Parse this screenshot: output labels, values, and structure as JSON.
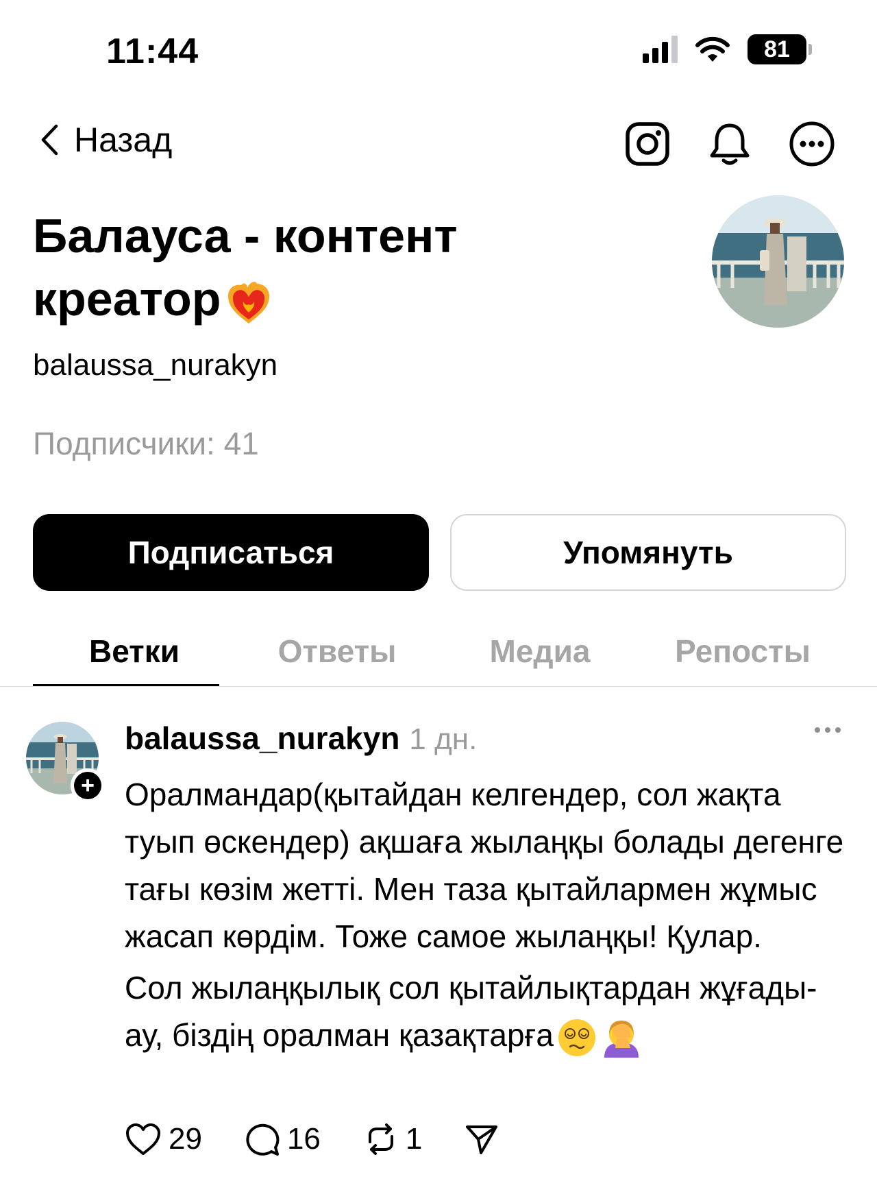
{
  "status_bar": {
    "time": "11:44",
    "battery": "81"
  },
  "nav": {
    "back_label": "Назад"
  },
  "profile": {
    "name": "Балауса - контент креатор",
    "handle": "balaussa_nurakyn",
    "followers": "Подписчики: 41"
  },
  "actions": {
    "follow_label": "Подписаться",
    "mention_label": "Упомянуть"
  },
  "tabs": [
    {
      "label": "Ветки",
      "active": true
    },
    {
      "label": "Ответы",
      "active": false
    },
    {
      "label": "Медиа",
      "active": false
    },
    {
      "label": "Репосты",
      "active": false
    }
  ],
  "post": {
    "author": "balaussa_nurakyn",
    "time": "1 дн.",
    "paragraph_1": "Оралмандар(қытайдан келгендер, сол жақта туып өскендер) ақшаға жылаңқы болады дегенге тағы көзім жетті. Мен таза қытайлармен жұмыс жасап көрдім. Тоже самое жылаңқы! Қулар.",
    "paragraph_2": "Сол жылаңқылық сол қытайлықтардан жұғады-ау, біздің оралман қазақтарға",
    "likes": "29",
    "replies": "16",
    "reposts": "1"
  },
  "icons": [
    "chevron-left-icon",
    "instagram-icon",
    "bell-icon",
    "more-circle-icon",
    "heart-icon",
    "comment-icon",
    "repost-icon",
    "share-icon",
    "more-dots-icon",
    "fire-heart-emoji",
    "dizzy-face-emoji",
    "facepalm-emoji"
  ]
}
